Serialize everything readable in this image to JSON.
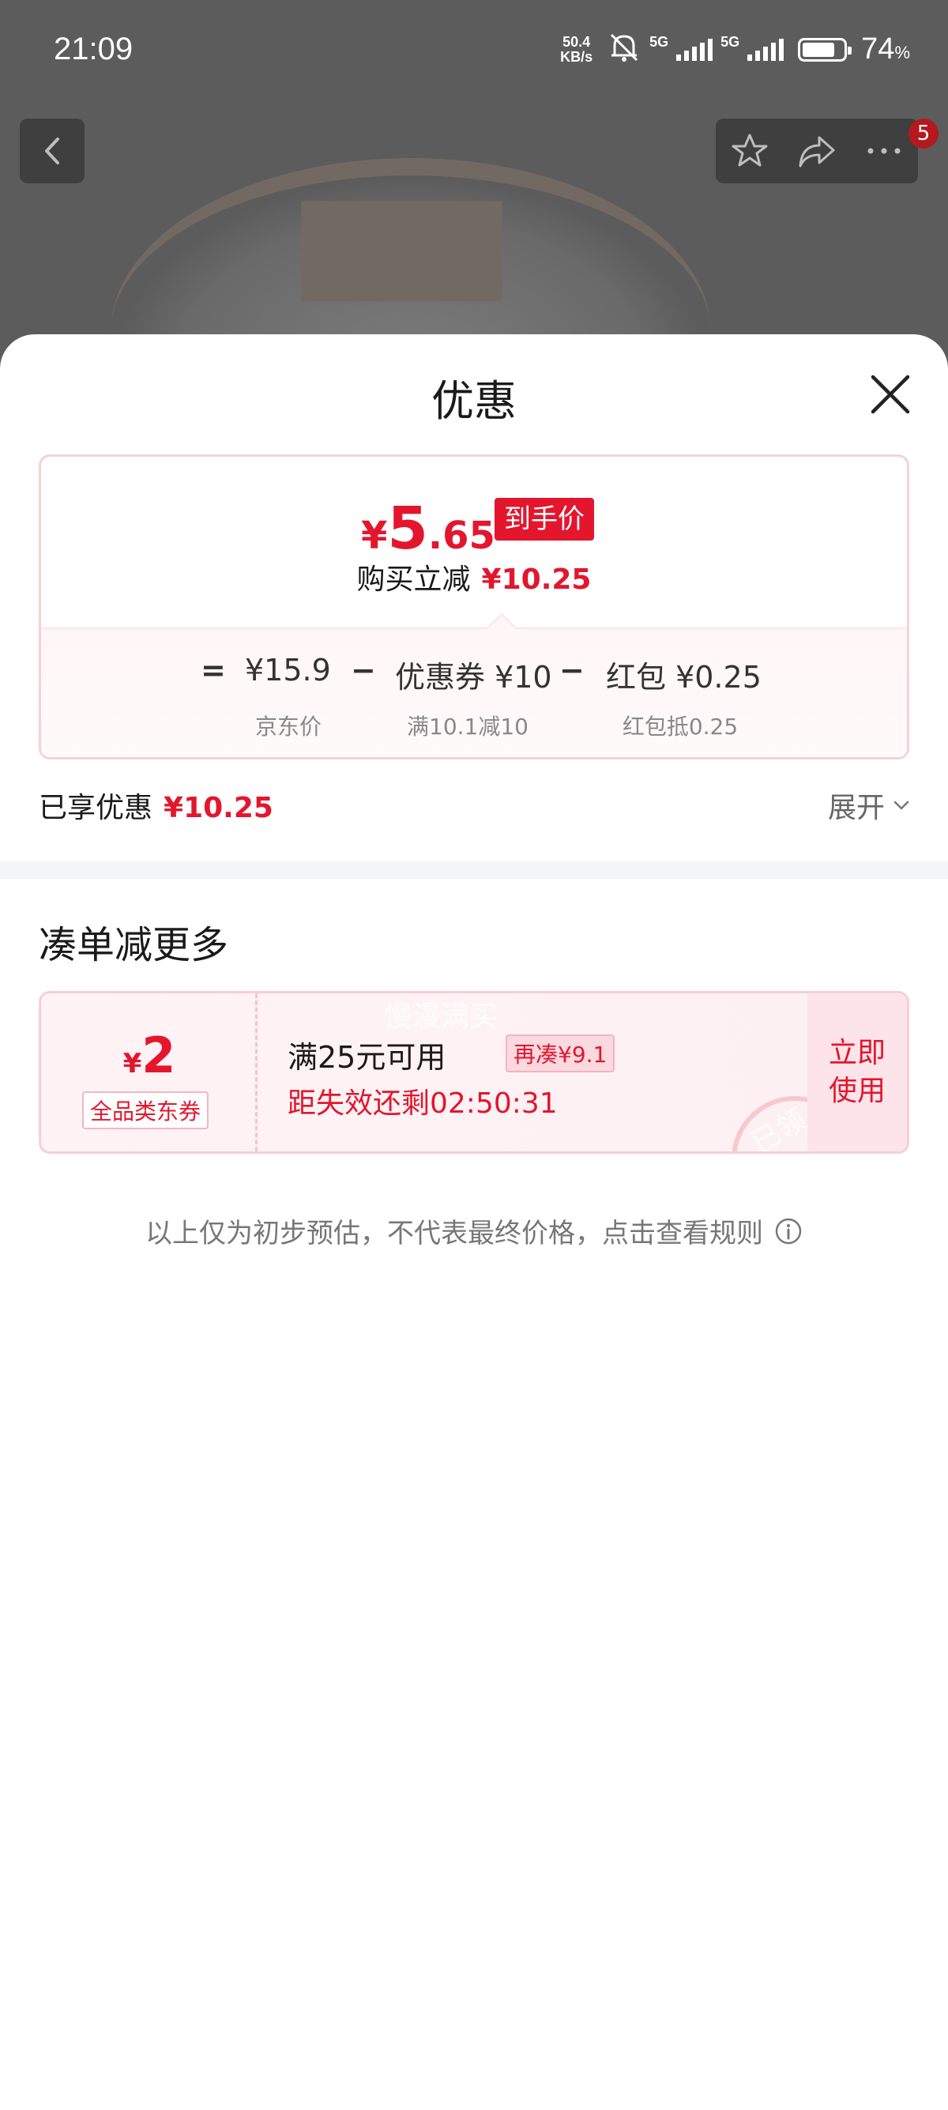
{
  "status_bar": {
    "time": "21:09",
    "net_speed_value": "50.4",
    "net_speed_unit": "KB/s",
    "signal_1": "5G",
    "signal_2": "5G",
    "battery": "74",
    "battery_unit": "%"
  },
  "nav": {
    "badge_count": "5",
    "icons": [
      "back-icon",
      "star-icon",
      "share-icon",
      "more-icon"
    ]
  },
  "sheet": {
    "title": "优惠",
    "final_price": {
      "yen": "¥",
      "integer": "5",
      "decimal": ".65",
      "tag": "到手价"
    },
    "reduce_label": "购买立减",
    "reduce_value": "¥10.25",
    "formula": {
      "equals": "=",
      "base_price": "¥15.9",
      "base_note": "京东价",
      "minus_1": "−",
      "coupon": "优惠券 ¥10",
      "coupon_note": "满10.1减10",
      "minus_2": "−",
      "redpacket": "红包 ¥0.25",
      "redpacket_note": "红包抵0.25"
    },
    "enjoyed_label": "已享优惠",
    "enjoyed_value": "¥10.25",
    "expand_label": "展开"
  },
  "more_section": {
    "title": "凑单减更多",
    "coupon": {
      "yen": "¥",
      "amount": "2",
      "type": "全品类东券",
      "watermark": "慢漫满买",
      "condition": "满25元可用",
      "more_tag": "再凑¥9.1",
      "expire": "距失效还剩02:50:31",
      "stamp": "已领",
      "use_line1": "立即",
      "use_line2": "使用"
    }
  },
  "disclaimer": "以上仅为初步预估，不代表最终价格，点击查看规则",
  "colors": {
    "accent": "#e3162d",
    "dim_overlay": "#5c5c5c",
    "divider": "#f4f5f9"
  }
}
